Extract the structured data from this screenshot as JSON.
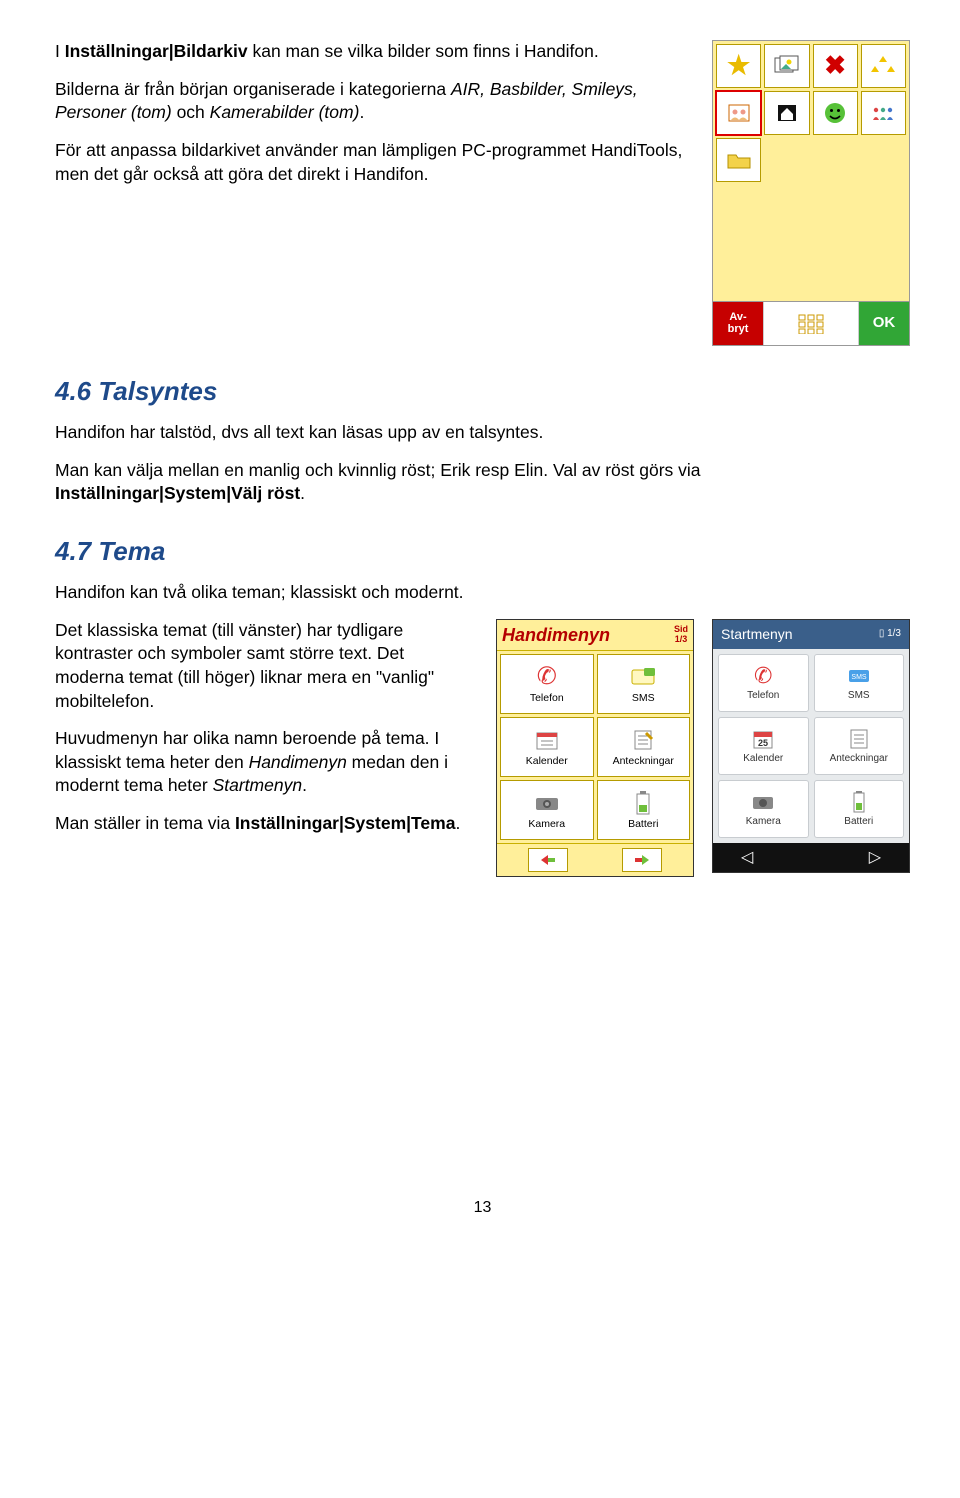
{
  "section_bildarkiv": {
    "p1_pre": "I ",
    "p1_bold": "Inställningar|Bildarkiv",
    "p1_post": " kan man se vilka bilder som finns i Handifon.",
    "p2_pre": "Bilderna är från början organiserade i kategorierna ",
    "p2_italic": "AIR, Basbilder, Smileys, Personer (tom)",
    "p2_mid": " och ",
    "p2_italic2": "Kamerabilder (tom)",
    "p2_post": ".",
    "p3": "För att anpassa bildarkivet använder man lämpligen PC-programmet HandiTools, men det går också att göra det direkt i Handifon."
  },
  "archive_device": {
    "avbryt": "Av-\nbryt",
    "ok": "OK"
  },
  "section_talsyntes": {
    "heading": "4.6 Talsyntes",
    "p1": "Handifon har talstöd, dvs all text kan läsas upp av en talsyntes.",
    "p2_pre": "Man kan välja mellan en manlig och kvinnlig röst; Erik resp Elin. Val av röst görs via ",
    "p2_bold": "Inställningar|System|Välj röst",
    "p2_post": "."
  },
  "section_tema": {
    "heading": "4.7 Tema",
    "p1": "Handifon kan två olika teman; klassiskt och modernt.",
    "p2": "Det klassiska temat (till vänster) har tydligare kontraster och symboler samt större text. Det moderna temat (till höger) liknar mera en \"vanlig\" mobiltelefon.",
    "p3_pre": "Huvudmenyn har olika namn beroende på tema. I klassiskt tema heter den ",
    "p3_i1": "Handimenyn",
    "p3_mid": " medan den i modernt tema heter ",
    "p3_i2": "Startmenyn",
    "p3_post": ".",
    "p4_pre": "Man ställer in tema via ",
    "p4_bold": "Inställningar|System|Tema",
    "p4_post": "."
  },
  "classic": {
    "title": "Handimenyn",
    "page_top": "Sid",
    "page_num": "1/3",
    "items": [
      "Telefon",
      "SMS",
      "Kalender",
      "Anteckningar",
      "Kamera",
      "Batteri"
    ]
  },
  "modern": {
    "title": "Startmenyn",
    "page": "1/3",
    "items": [
      "Telefon",
      "SMS",
      "Kalender",
      "Anteckningar",
      "Kamera",
      "Batteri"
    ]
  },
  "page_number": "13"
}
